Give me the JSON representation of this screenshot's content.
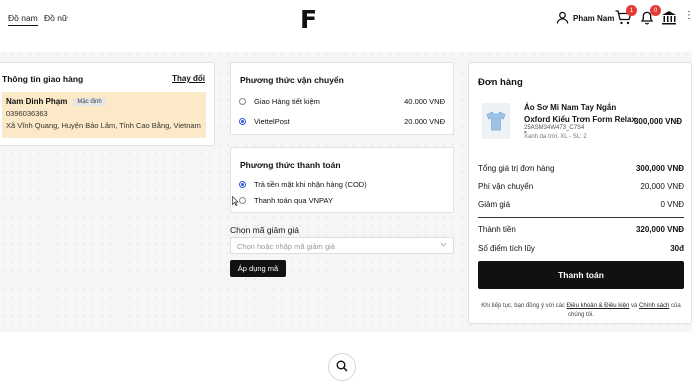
{
  "header": {
    "nav": [
      "Đồ nam",
      "Đồ nữ"
    ],
    "logo": "F",
    "user_name": "Pham Nam",
    "cart_count": "1",
    "notif_count": "0",
    "more": "⋮"
  },
  "shipping_info": {
    "title": "Thông tin giao hàng",
    "change_label": "Thay đổi",
    "name": "Nam Dinh Phạm",
    "default_tag": "Mặc định",
    "phone": "0396036363",
    "address": "Xã Vĩnh Quang, Huyện Bảo Lâm, Tỉnh Cao Bằng, Vietnam"
  },
  "shipping_method": {
    "title": "Phương thức vận chuyển",
    "options": [
      {
        "label": "Giao Hàng tiết kiệm",
        "price": "40.000 VNĐ",
        "selected": false
      },
      {
        "label": "ViettelPost",
        "price": "20.000 VNĐ",
        "selected": true
      }
    ]
  },
  "payment_method": {
    "title": "Phương thức thanh toán",
    "options": [
      {
        "label": "Trả tiền mặt khi nhận hàng (COD)",
        "selected": true
      },
      {
        "label": "Thanh toán qua VNPAY",
        "selected": false
      }
    ]
  },
  "coupon": {
    "label": "Chọn mã giảm giá",
    "placeholder": "Chọn hoặc nhập mã giảm giá",
    "apply_label": "Áp dụng mã"
  },
  "order": {
    "title": "Đơn hàng",
    "product": {
      "name": "Áo Sơ Mi Nam Tay Ngắn Oxford Kiểu Trơn Form Relax -",
      "sku": "25ASM34W473_C7S4",
      "variant": "Xanh da trời, XL - SL: 2",
      "price": "300,000 VNĐ"
    },
    "summary": {
      "subtotal_label": "Tổng giá trị đơn hàng",
      "subtotal": "300,000 VNĐ",
      "shipping_label": "Phí vận chuyển",
      "shipping": "20,000 VNĐ",
      "discount_label": "Giảm giá",
      "discount": "0 VNĐ",
      "total_label": "Thành tiền",
      "total": "320,000 VNĐ",
      "points_label": "Số điểm tích lũy",
      "points": "30đ"
    },
    "checkout_label": "Thanh toán",
    "terms_prefix": "Khi tiếp tục, bạn đồng ý với các",
    "terms_link": "Điều khoản & Điều kiện",
    "terms_and": "và",
    "policy_link": "Chính sách",
    "terms_suffix": "của chúng tôi."
  },
  "colors": {
    "accent": "#111111",
    "address_bg": "#fce9c8",
    "badge": "#e53935",
    "radio": "#2a5bd7"
  }
}
